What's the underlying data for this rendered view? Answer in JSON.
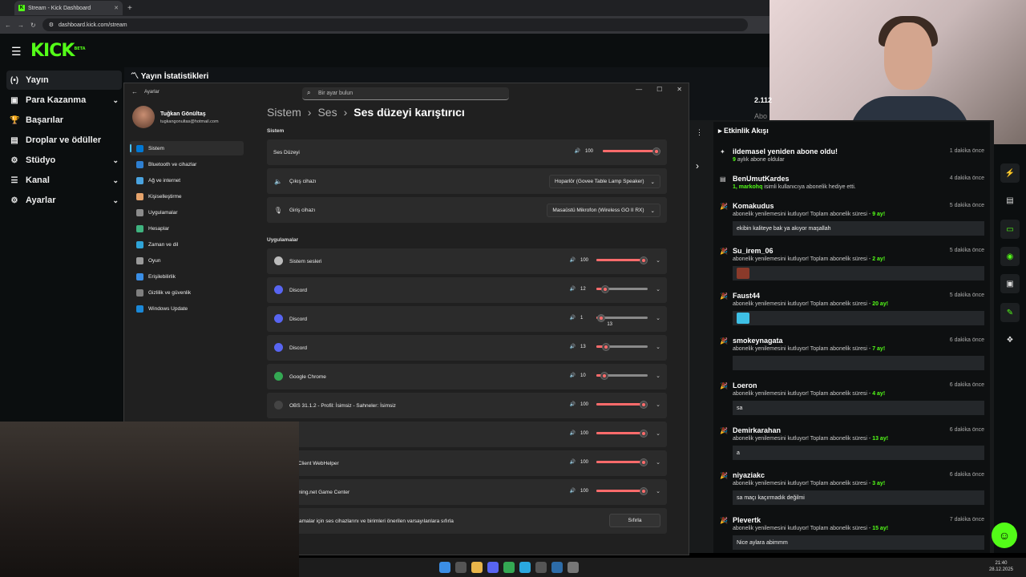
{
  "browser": {
    "tab_title": "Stream - Kick Dashboard",
    "url": "dashboard.kick.com/stream",
    "new_tab": "+"
  },
  "kick": {
    "logo": "KICK",
    "beta": "BETA",
    "nav": [
      {
        "label": "Yayın",
        "icon": "broadcast-icon"
      },
      {
        "label": "Para Kazanma",
        "icon": "dollar-icon"
      },
      {
        "label": "Başarılar",
        "icon": "trophy-icon"
      },
      {
        "label": "Droplar ve ödüller",
        "icon": "gift-icon"
      },
      {
        "label": "Stüdyo",
        "icon": "studio-icon"
      },
      {
        "label": "Kanal",
        "icon": "channel-icon"
      },
      {
        "label": "Ayarlar",
        "icon": "gear-icon"
      }
    ],
    "stats_title": "Yayın İstatistikleri",
    "stats_value": "2.112",
    "stats_sub": "Abo"
  },
  "settings": {
    "app": "Ayarlar",
    "search_placeholder": "Bir ayar bulun",
    "user_name": "Tuğkan Gönültaş",
    "user_email": "tugkangonultas@hotmail.com",
    "nav": [
      {
        "label": "Sistem",
        "color": "#0078d4"
      },
      {
        "label": "Bluetooth ve cihazlar",
        "color": "#2e7fd1"
      },
      {
        "label": "Ağ ve internet",
        "color": "#4aa3df"
      },
      {
        "label": "Kişiselleştirme",
        "color": "#e6a36b"
      },
      {
        "label": "Uygulamalar",
        "color": "#8c8c8c"
      },
      {
        "label": "Hesaplar",
        "color": "#3fb37f"
      },
      {
        "label": "Zaman ve dil",
        "color": "#2fa4d8"
      },
      {
        "label": "Oyun",
        "color": "#9a9a9a"
      },
      {
        "label": "Erişilebilirlik",
        "color": "#3a8ee6"
      },
      {
        "label": "Gizlilik ve güvenlik",
        "color": "#7f7f7f"
      },
      {
        "label": "Windows Update",
        "color": "#1a88d8"
      }
    ],
    "crumb": [
      "Sistem",
      "Ses",
      "Ses düzeyi karıştırıcı"
    ],
    "section_system": "Sistem",
    "master": {
      "label": "Ses Düzeyi",
      "value": "100",
      "level": 100
    },
    "output": {
      "label": "Çıkış cihazı",
      "value": "Hoparlör (Govee Table Lamp Speaker)"
    },
    "input": {
      "label": "Giriş cihazı",
      "value": "Masaüstü Mikrofon (Wireless GO II RX)"
    },
    "section_apps": "Uygulamalar",
    "apps": [
      {
        "name": "Sistem sesleri",
        "value": "100",
        "level": 100,
        "icon": "speaker-icon"
      },
      {
        "name": "Discord",
        "value": "12",
        "level": 12,
        "icon": "discord-icon"
      },
      {
        "name": "Discord",
        "value": "1",
        "level": 1,
        "icon": "discord-icon",
        "tooltip": "13"
      },
      {
        "name": "Discord",
        "value": "13",
        "level": 13,
        "icon": "discord-icon"
      },
      {
        "name": "Google Chrome",
        "value": "10",
        "level": 10,
        "icon": "chrome-icon"
      },
      {
        "name": "OBS 31.1.2 - Profil: İsimsiz - Sahneler: İsimsiz",
        "value": "100",
        "level": 100,
        "icon": "obs-icon"
      },
      {
        "name": "am",
        "value": "100",
        "level": 100,
        "icon": "steam-icon"
      },
      {
        "name": "am Client WebHelper",
        "value": "100",
        "level": 100,
        "icon": "steam-icon"
      },
      {
        "name": "rgaming.net Game Center",
        "value": "100",
        "level": 100,
        "icon": "wargaming-icon"
      }
    ],
    "reset_text": "amalar için ses cihazlarını ve birimleri önerilen varsayılanlara sıfırla",
    "reset_button": "Sıfırla"
  },
  "feed": {
    "title": "Etkinlik Akışı",
    "events": [
      {
        "name": "ildemasel yeniden abone oldu!",
        "time": "1 dakika önce",
        "sub_hl": "9",
        "sub": " aylık abone oldular",
        "icon": "star-icon"
      },
      {
        "name": "BenUmutKardes",
        "time": "4 dakika önce",
        "sub_hl": "1, markohq",
        "sub": " isimli kullanıcıya abonelik hediye etti.",
        "icon": "gift-icon"
      },
      {
        "name": "Komakudus",
        "time": "5 dakika önce",
        "sub": "abonelik yenilemesini kutluyor! Toplam abonelik süresi - ",
        "sub_hl": "9",
        "sub2": " ay!",
        "msg": "ekibin kaliteye bak ya akıyor maşallah",
        "icon": "party-icon"
      },
      {
        "name": "Su_irem_06",
        "time": "5 dakika önce",
        "sub": "abonelik yenilemesini kutluyor! Toplam abonelik süresi - ",
        "sub_hl": "2",
        "sub2": " ay!",
        "msg": "",
        "thumb": "#8a3a2a",
        "icon": "party-icon"
      },
      {
        "name": "Faust44",
        "time": "5 dakika önce",
        "sub": "abonelik yenilemesini kutluyor! Toplam abonelik süresi - ",
        "sub_hl": "20",
        "sub2": " ay!",
        "msg": "",
        "thumb": "#3ec0e6",
        "icon": "party-icon"
      },
      {
        "name": "smokeynagata",
        "time": "6 dakika önce",
        "sub": "abonelik yenilemesini kutluyor! Toplam abonelik süresi - ",
        "sub_hl": "7",
        "sub2": " ay!",
        "msg": "",
        "icon": "party-icon"
      },
      {
        "name": "Loeron",
        "time": "6 dakika önce",
        "sub": "abonelik yenilemesini kutluyor! Toplam abonelik süresi - ",
        "sub_hl": "4",
        "sub2": " ay!",
        "msg": "sa",
        "icon": "party-icon"
      },
      {
        "name": "Demirkarahan",
        "time": "6 dakika önce",
        "sub": "abonelik yenilemesini kutluyor! Toplam abonelik süresi - ",
        "sub_hl": "13",
        "sub2": " ay!",
        "msg": "a",
        "icon": "party-icon"
      },
      {
        "name": "niyaziakc",
        "time": "6 dakika önce",
        "sub": "abonelik yenilemesini kutluyor! Toplam abonelik süresi - ",
        "sub_hl": "3",
        "sub2": " ay!",
        "msg": "sa maçı kaçırmadık değilmi",
        "icon": "party-icon"
      },
      {
        "name": "Plevertk",
        "time": "7 dakika önce",
        "sub": "abonelik yenilemesini kutluyor! Toplam abonelik süresi - ",
        "sub_hl": "15",
        "sub2": " ay!",
        "msg": "Nice aylara abimmm",
        "icon": "party-icon"
      }
    ]
  },
  "taskbar": {
    "time": "21:40",
    "date": "28.12.2025"
  },
  "colors": {
    "kick_green": "#53fc18",
    "slider_accent": "#ff6b6b",
    "windows_accent": "#4cc2ff"
  }
}
